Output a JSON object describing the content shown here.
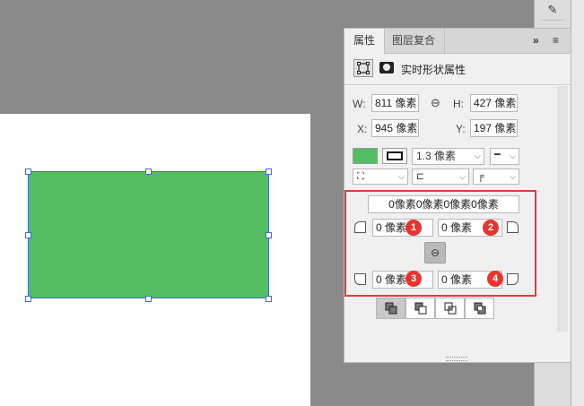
{
  "panel": {
    "tabs": [
      {
        "label": "属性",
        "active": true
      },
      {
        "label": "图层复合",
        "active": false
      }
    ],
    "collapse_icon": "»",
    "menu_icon": "≡",
    "title": "实时形状属性"
  },
  "transform": {
    "w_label": "W:",
    "w_value": "811 像素",
    "h_label": "H:",
    "h_value": "427 像素",
    "x_label": "X:",
    "x_value": "945 像素",
    "y_label": "Y:",
    "y_value": "197 像素"
  },
  "appearance": {
    "fill_color": "#55bd62",
    "stroke_width": "1.3 像素"
  },
  "corners": {
    "all_radii": "0像素0像素0像素0像素",
    "top_left": "0 像素",
    "top_right": "0 像素",
    "bottom_left": "0 像素",
    "bottom_right": "0 像素"
  },
  "badges": [
    "1",
    "2",
    "3",
    "4"
  ],
  "colors": {
    "highlight": "#e23b3b",
    "badge": "#e8342f",
    "selection": "#3a6fcf"
  }
}
